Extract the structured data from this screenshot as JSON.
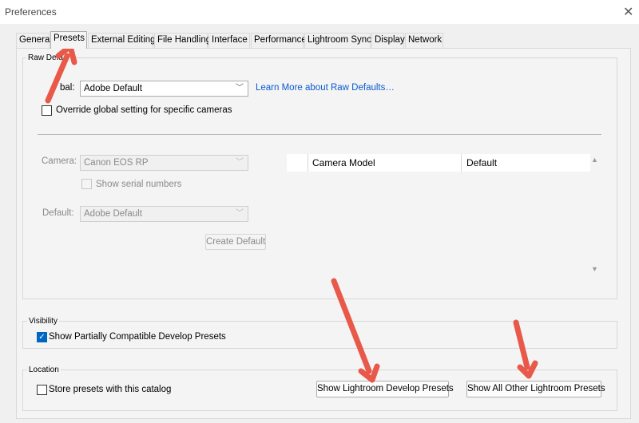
{
  "window": {
    "title": "Preferences"
  },
  "tabs": [
    {
      "label": "General"
    },
    {
      "label": "Presets"
    },
    {
      "label": "External Editing"
    },
    {
      "label": "File Handling"
    },
    {
      "label": "Interface"
    },
    {
      "label": "Performance"
    },
    {
      "label": "Lightroom Sync"
    },
    {
      "label": "Display"
    },
    {
      "label": "Network"
    }
  ],
  "active_tab": "Presets",
  "raw_defaults": {
    "group_label": "Raw Defa",
    "global_label": "bal:",
    "global_value": "Adobe Default",
    "learn_more": "Learn More about Raw Defaults…",
    "override_label": "Override global setting for specific cameras",
    "camera_label": "Camera:",
    "camera_value": "Canon EOS RP",
    "show_serial_label": "Show serial numbers",
    "default_label": "Default:",
    "default_value": "Adobe Default",
    "create_default": "Create Default",
    "table_columns": [
      "Camera Model",
      "Default"
    ]
  },
  "visibility": {
    "group_label": "Visibility",
    "show_partial_label": "Show Partially Compatible Develop Presets",
    "show_partial_checked": true
  },
  "location": {
    "group_label": "Location",
    "store_label": "Store presets with this catalog",
    "store_checked": false,
    "btn_develop": "Show Lightroom Develop Presets",
    "btn_other": "Show All Other Lightroom Presets"
  },
  "colors": {
    "annotation_arrow": "#e8594a",
    "link": "#0a5ad1",
    "check_accent": "#0067c0"
  }
}
